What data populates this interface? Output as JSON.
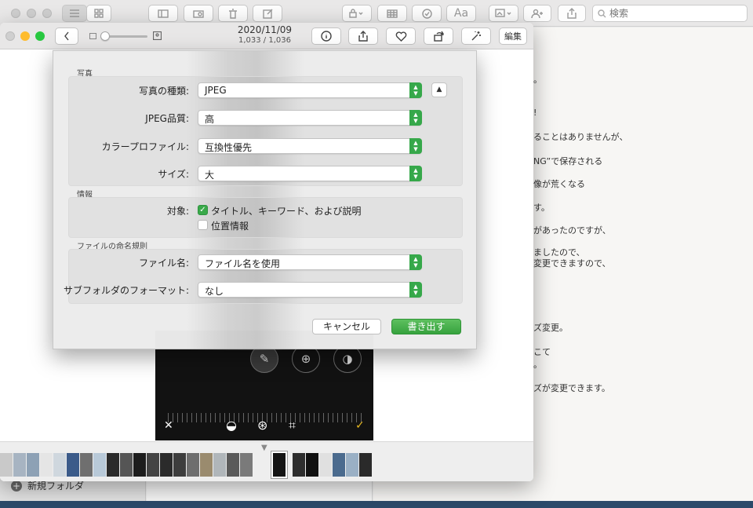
{
  "notes": {
    "search_placeholder": "検索",
    "new_folder": "新規フォルダ",
    "font_button": "Aa",
    "editor_lines": [
      "。",
      "!",
      "ることはありませんが、",
      "NG”で保存される",
      "像が荒くなる",
      "す。",
      "があったのですが、",
      "ましたので、",
      "変更できますので、",
      "ズ変更。",
      "こて",
      "。",
      "ズが変更できます。"
    ]
  },
  "photos": {
    "date": "2020/11/09",
    "count": "1,033 / 1,036",
    "edit_label": "編集",
    "thumb_colors": [
      "#c9c9c9",
      "#a7b4c2",
      "#8da1b5",
      "#e5e5e5",
      "#cfd7de",
      "#3b5b8a",
      "#6f6f6f",
      "#b8c9d8",
      "#2a2a2a",
      "#555",
      "#1d1d1d",
      "#444",
      "#2b2b2b",
      "#3d3d3d",
      "#6e6e6e",
      "#9a8b6e",
      "#b0b6ba",
      "#5a5a5a",
      "#7a7a7a",
      "#eeeeee",
      "#141414",
      "#2e2e2e",
      "#111111",
      "#e0e0e0",
      "#4b6b8e",
      "#9ab0c5",
      "#2a2a2a"
    ]
  },
  "export_sheet": {
    "section_photo": "写真",
    "label_type": "写真の種類:",
    "value_type": "JPEG",
    "label_quality": "JPEG品質:",
    "value_quality": "高",
    "label_profile": "カラープロファイル:",
    "value_profile": "互換性優先",
    "label_size": "サイズ:",
    "value_size": "大",
    "section_info": "情報",
    "label_target": "対象:",
    "check_title": "タイトル、キーワード、および説明",
    "check_title_on": true,
    "check_location": "位置情報",
    "check_location_on": false,
    "section_naming": "ファイルの命名規則",
    "label_filename": "ファイル名:",
    "value_filename": "ファイル名を使用",
    "label_subfolder": "サブフォルダのフォーマット:",
    "value_subfolder": "なし",
    "cancel_label": "キャンセル",
    "export_label": "書き出す"
  },
  "colors": {
    "accent_green": "#37a23e",
    "traffic_red": "#fd5f57",
    "traffic_yellow": "#febc2e",
    "traffic_green": "#28c840"
  }
}
